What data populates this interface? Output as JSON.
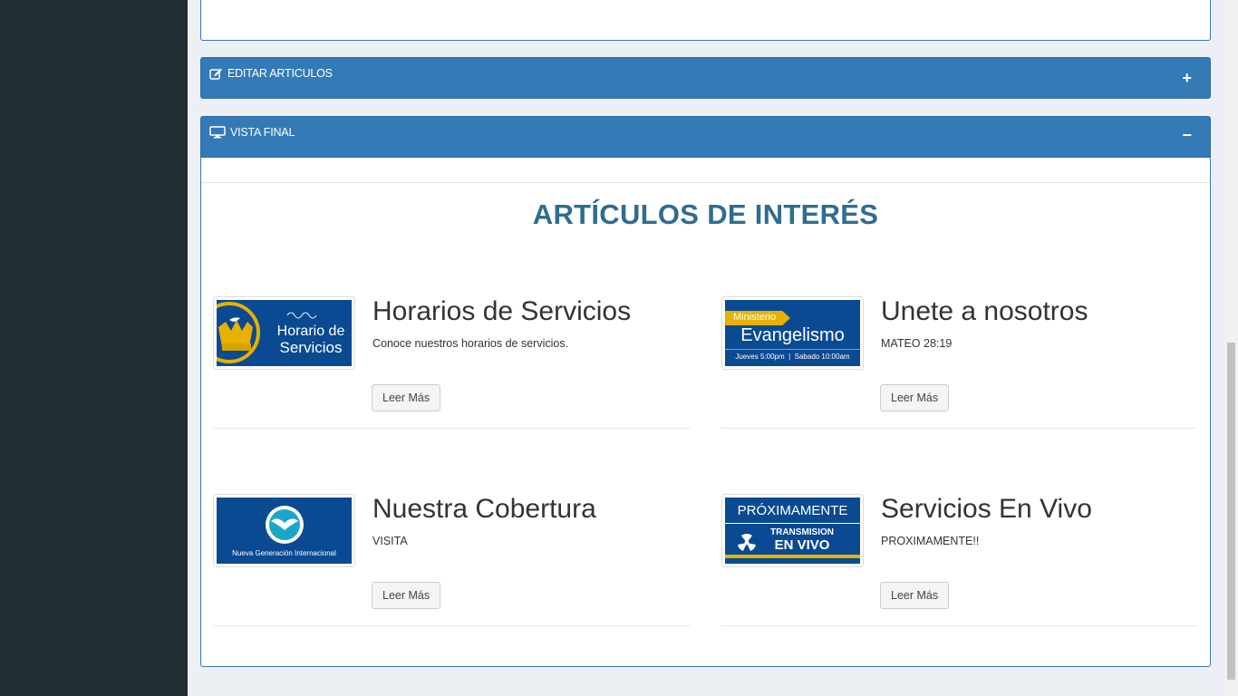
{
  "panels": {
    "edit": {
      "title": "EDITAR ARTICULOS",
      "toggle": "+",
      "icon": "edit-icon"
    },
    "preview": {
      "title": "VISTA FINAL",
      "toggle": "−",
      "icon": "monitor-icon"
    }
  },
  "section": {
    "title": "ARTÍCULOS DE INTERÉS"
  },
  "articles": [
    {
      "title": "Horarios de Servicios",
      "description": "Conoce nuestros horarios de servicios.",
      "button": "Leer Más",
      "image": {
        "line1": "Horario de",
        "line2": "Servicios"
      }
    },
    {
      "title": "Unete a nosotros",
      "description": "MATEO 28:19",
      "button": "Leer Más",
      "image": {
        "tag": "Ministerio",
        "main": "Evangelismo",
        "sub": "Jueves 5:00pm  |  Sabado 10:00am"
      }
    },
    {
      "title": "Nuestra Cobertura",
      "description": "VISITA",
      "button": "Leer Más",
      "image": {
        "caption": "Nueva Generación Internacional"
      }
    },
    {
      "title": "Servicios En Vivo",
      "description": "PROXIMAMENTE!!",
      "button": "Leer Más",
      "image": {
        "line1": "PRÓXIMAMENTE",
        "line2": "TRANSMISION",
        "line3": "EN VIVO"
      }
    }
  ],
  "colors": {
    "header": "#337ab7",
    "sidebar": "#222d32",
    "title": "#2f6d8f",
    "image_bg": "#0a4a92",
    "gold": "#e8b000"
  }
}
